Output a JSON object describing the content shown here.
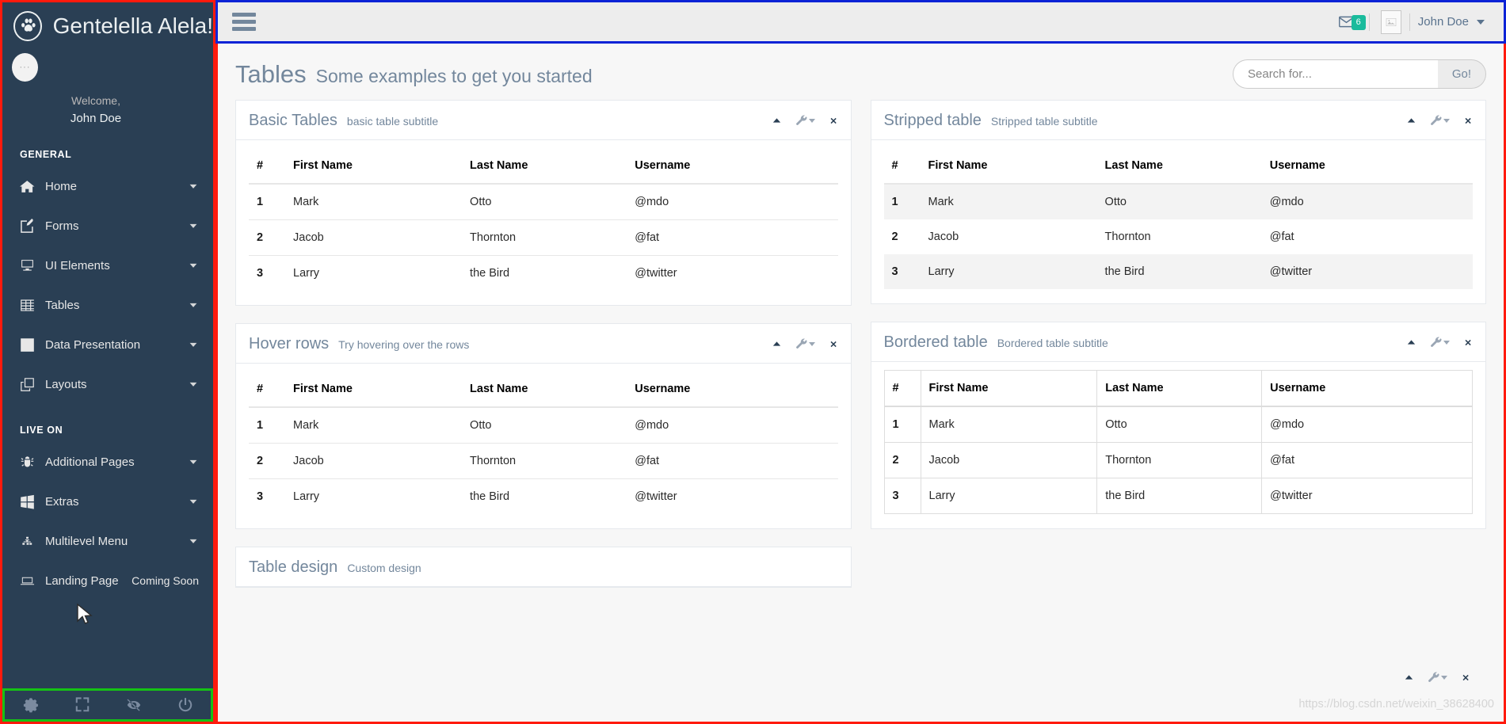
{
  "sidebar": {
    "brand": {
      "title": "Gentelella Alela!",
      "logo_icon": "paw-icon"
    },
    "profile": {
      "welcome_label": "Welcome,",
      "user_name": "John Doe"
    },
    "sections": [
      {
        "title": "GENERAL",
        "items": [
          {
            "label": "Home",
            "icon": "home-icon",
            "chevron": "chevron-down-icon"
          },
          {
            "label": "Forms",
            "icon": "edit-pencil-icon",
            "chevron": "chevron-down-icon"
          },
          {
            "label": "UI Elements",
            "icon": "desktop-monitor-icon",
            "chevron": "chevron-down-icon"
          },
          {
            "label": "Tables",
            "icon": "table-grid-icon",
            "chevron": "chevron-down-icon"
          },
          {
            "label": "Data Presentation",
            "icon": "bar-chart-icon",
            "chevron": "chevron-down-icon"
          },
          {
            "label": "Layouts",
            "icon": "clone-windows-icon",
            "chevron": "chevron-down-icon"
          }
        ]
      },
      {
        "title": "LIVE ON",
        "items": [
          {
            "label": "Additional Pages",
            "icon": "bug-icon",
            "chevron": "chevron-down-icon"
          },
          {
            "label": "Extras",
            "icon": "windows-icon",
            "chevron": "chevron-down-icon"
          },
          {
            "label": "Multilevel Menu",
            "icon": "sitemap-icon",
            "chevron": "chevron-down-icon"
          },
          {
            "label": "Landing Page",
            "icon": "laptop-icon",
            "badge": "Coming Soon"
          }
        ]
      }
    ],
    "footer_icons": [
      {
        "name": "settings-gear-icon"
      },
      {
        "name": "fullscreen-expand-icon"
      },
      {
        "name": "eye-slash-lock-icon"
      },
      {
        "name": "power-off-icon"
      }
    ]
  },
  "topnav": {
    "menu_toggle_icon": "hamburger-menu-icon",
    "mail_icon": "envelope-icon",
    "mail_badge": "6",
    "avatar_icon": "broken-image-icon",
    "user_name": "John Doe",
    "caret_icon": "caret-down-icon"
  },
  "page": {
    "title": "Tables",
    "subtitle": "Some examples to get you started",
    "search": {
      "placeholder": "Search for...",
      "value": "",
      "button_label": "Go!"
    },
    "watermark": "https://blog.csdn.net/weixin_38628400"
  },
  "tools": {
    "collapse_icon": "chevron-up-icon",
    "settings_icon": "wrench-icon",
    "close_icon": "close-x-icon"
  },
  "table_columns": [
    "#",
    "First Name",
    "Last Name",
    "Username"
  ],
  "table_rows": [
    {
      "idx": "1",
      "first": "Mark",
      "last": "Otto",
      "username": "@mdo"
    },
    {
      "idx": "2",
      "first": "Jacob",
      "last": "Thornton",
      "username": "@fat"
    },
    {
      "idx": "3",
      "first": "Larry",
      "last": "the Bird",
      "username": "@twitter"
    }
  ],
  "panels": {
    "basic": {
      "title": "Basic Tables",
      "subtitle": "basic table subtitle"
    },
    "hover": {
      "title": "Hover rows",
      "subtitle": "Try hovering over the rows"
    },
    "stripped": {
      "title": "Stripped table",
      "subtitle": "Stripped table subtitle"
    },
    "bordered": {
      "title": "Bordered table",
      "subtitle": "Bordered table subtitle"
    },
    "design": {
      "title": "Table design",
      "subtitle": "Custom design"
    }
  },
  "colors": {
    "sidebar_bg": "#2A3F54",
    "accent_teal": "#1ABB9C",
    "text_muted": "#73879C",
    "outline_red": "#ff1a0d",
    "outline_blue": "#0c23d6",
    "outline_green": "#15c215"
  }
}
